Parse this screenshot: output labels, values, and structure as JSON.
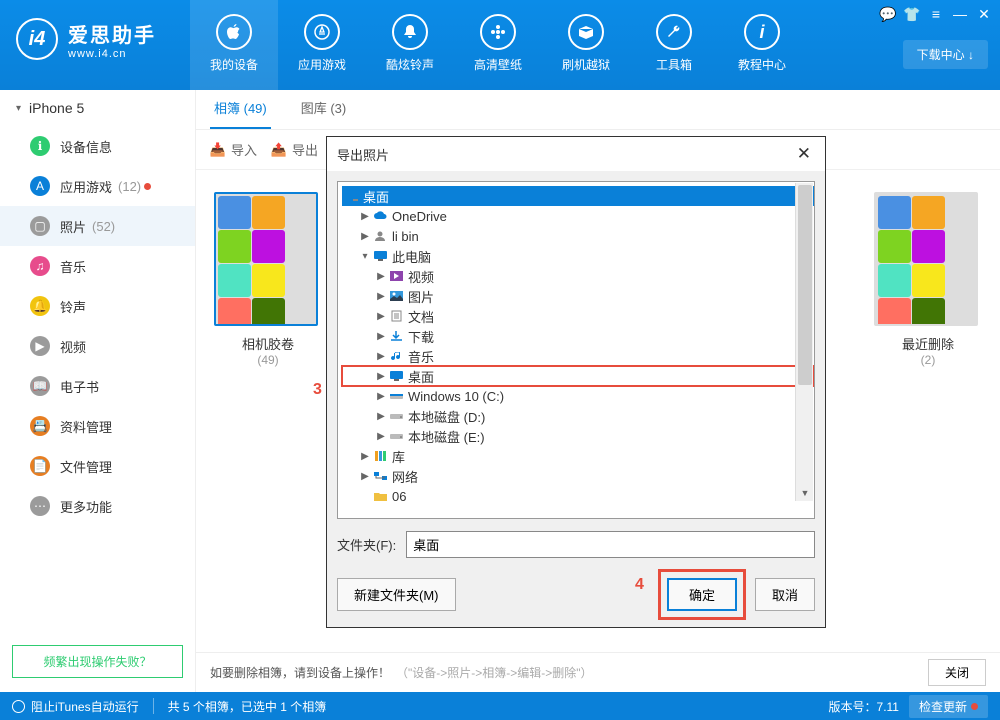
{
  "app": {
    "title": "爱思助手",
    "url": "www.i4.cn",
    "download_center": "下载中心 ↓"
  },
  "topnav": [
    {
      "label": "我的设备"
    },
    {
      "label": "应用游戏"
    },
    {
      "label": "酷炫铃声"
    },
    {
      "label": "高清壁纸"
    },
    {
      "label": "刷机越狱"
    },
    {
      "label": "工具箱"
    },
    {
      "label": "教程中心"
    }
  ],
  "sidebar": {
    "device": "iPhone 5",
    "items": [
      {
        "label": "设备信息",
        "count": "",
        "color": "#2ecc71",
        "active": false
      },
      {
        "label": "应用游戏",
        "count": "(12)",
        "color": "#0a80d8",
        "active": false,
        "dot": true
      },
      {
        "label": "照片",
        "count": "(52)",
        "color": "#9b9b9b",
        "active": true
      },
      {
        "label": "音乐",
        "count": "",
        "color": "#e74c8c",
        "active": false
      },
      {
        "label": "铃声",
        "count": "",
        "color": "#f1c40f",
        "active": false
      },
      {
        "label": "视频",
        "count": "",
        "color": "#9b9b9b",
        "active": false
      },
      {
        "label": "电子书",
        "count": "",
        "color": "#9b9b9b",
        "active": false
      },
      {
        "label": "资料管理",
        "count": "",
        "color": "#e67e22",
        "active": false
      },
      {
        "label": "文件管理",
        "count": "",
        "color": "#e67e22",
        "active": false
      },
      {
        "label": "更多功能",
        "count": "",
        "color": "#9b9b9b",
        "active": false
      }
    ],
    "footer": "频繁出现操作失败？"
  },
  "subtabs": [
    {
      "label": "相簿 (49)",
      "active": true
    },
    {
      "label": "图库 (3)",
      "active": false
    }
  ],
  "toolbar": {
    "import": "导入",
    "export": "导出"
  },
  "albums": [
    {
      "name": "相机胶卷",
      "count": "(49)"
    },
    {
      "name": "最近删除",
      "count": "(2)"
    }
  ],
  "bottom_tip": {
    "prefix": "如要删除相簿，请到设备上操作！",
    "hint": "（\"设备->照片->相簿->编辑->删除\"）",
    "close": "关闭"
  },
  "status": {
    "itunes": "阻止iTunes自动运行",
    "summary": "共 5 个相簿，已选中 1 个相簿",
    "version_label": "版本号：",
    "version": "7.11",
    "update": "检查更新"
  },
  "dialog": {
    "title": "导出照片",
    "header": "桌面",
    "tree": [
      {
        "indent": 1,
        "exp": "▶",
        "label": "OneDrive",
        "kind": "cloud"
      },
      {
        "indent": 1,
        "exp": "▶",
        "label": "li bin",
        "kind": "user"
      },
      {
        "indent": 1,
        "exp": "▾",
        "label": "此电脑",
        "kind": "pc"
      },
      {
        "indent": 2,
        "exp": "▶",
        "label": "视频",
        "kind": "video"
      },
      {
        "indent": 2,
        "exp": "▶",
        "label": "图片",
        "kind": "pic"
      },
      {
        "indent": 2,
        "exp": "▶",
        "label": "文档",
        "kind": "doc"
      },
      {
        "indent": 2,
        "exp": "▶",
        "label": "下载",
        "kind": "dl"
      },
      {
        "indent": 2,
        "exp": "▶",
        "label": "音乐",
        "kind": "music"
      },
      {
        "indent": 2,
        "exp": "▶",
        "label": "桌面",
        "kind": "desktop",
        "hl": true
      },
      {
        "indent": 2,
        "exp": "▶",
        "label": "Windows 10 (C:)",
        "kind": "cdrive"
      },
      {
        "indent": 2,
        "exp": "▶",
        "label": "本地磁盘 (D:)",
        "kind": "drive"
      },
      {
        "indent": 2,
        "exp": "▶",
        "label": "本地磁盘 (E:)",
        "kind": "drive"
      },
      {
        "indent": 1,
        "exp": "▶",
        "label": "库",
        "kind": "lib"
      },
      {
        "indent": 1,
        "exp": "▶",
        "label": "网络",
        "kind": "net"
      },
      {
        "indent": 1,
        "exp": " ",
        "label": "06",
        "kind": "folder"
      }
    ],
    "folder_label": "文件夹(F):",
    "folder_value": "桌面",
    "new_folder": "新建文件夹(M)",
    "ok": "确定",
    "cancel": "取消",
    "ann3": "3",
    "ann4": "4"
  }
}
